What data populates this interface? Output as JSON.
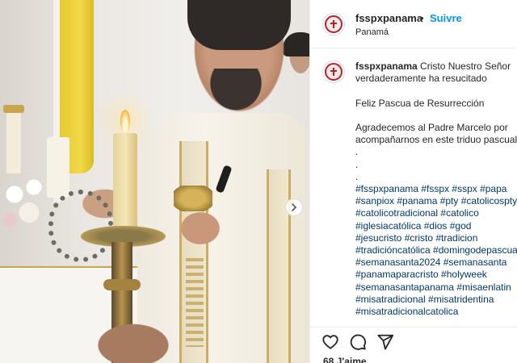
{
  "post": {
    "username": "fssp­xpanama",
    "separator": "•",
    "follow_label": "Suivre",
    "location": "Panamá",
    "likes_partial": "68 J'aime"
  },
  "caption": {
    "username": "fsspxpanama",
    "lines": [
      "Cristo Nuestro Señor",
      "verdaderamente ha resucitado",
      "",
      "Feliz Pascua de Resurrección",
      "",
      "Agradecemos al Padre Marcelo por",
      "acompañarnos en este triduo pascual",
      ".",
      ".",
      "."
    ],
    "hashtag_lines": [
      "#fsspxpanama #fsspx #sspx #papa",
      "#sanpiox #panama #pty #catolicospty",
      "#catolicotradicional #catolico",
      "#iglesiacatólica #dios #god",
      "#jesucristo #cristo #tradicion",
      "#tradicióncatólica #domingodepascua",
      "#semanasanta2024 #semanasanta",
      "#panamaparacristo #holyweek",
      "#semanasantapanama #misaenlatin",
      "#misatradicional #misatridentina",
      "#misatradicionalcatolica"
    ]
  },
  "icons": {
    "like": "heart-icon",
    "comment": "comment-icon",
    "share": "share-icon",
    "carousel": "chevron-right-icon"
  },
  "colors": {
    "link": "#0095f6",
    "hashtag": "#00376b",
    "text": "#262626",
    "brand_red": "#b7212e"
  }
}
